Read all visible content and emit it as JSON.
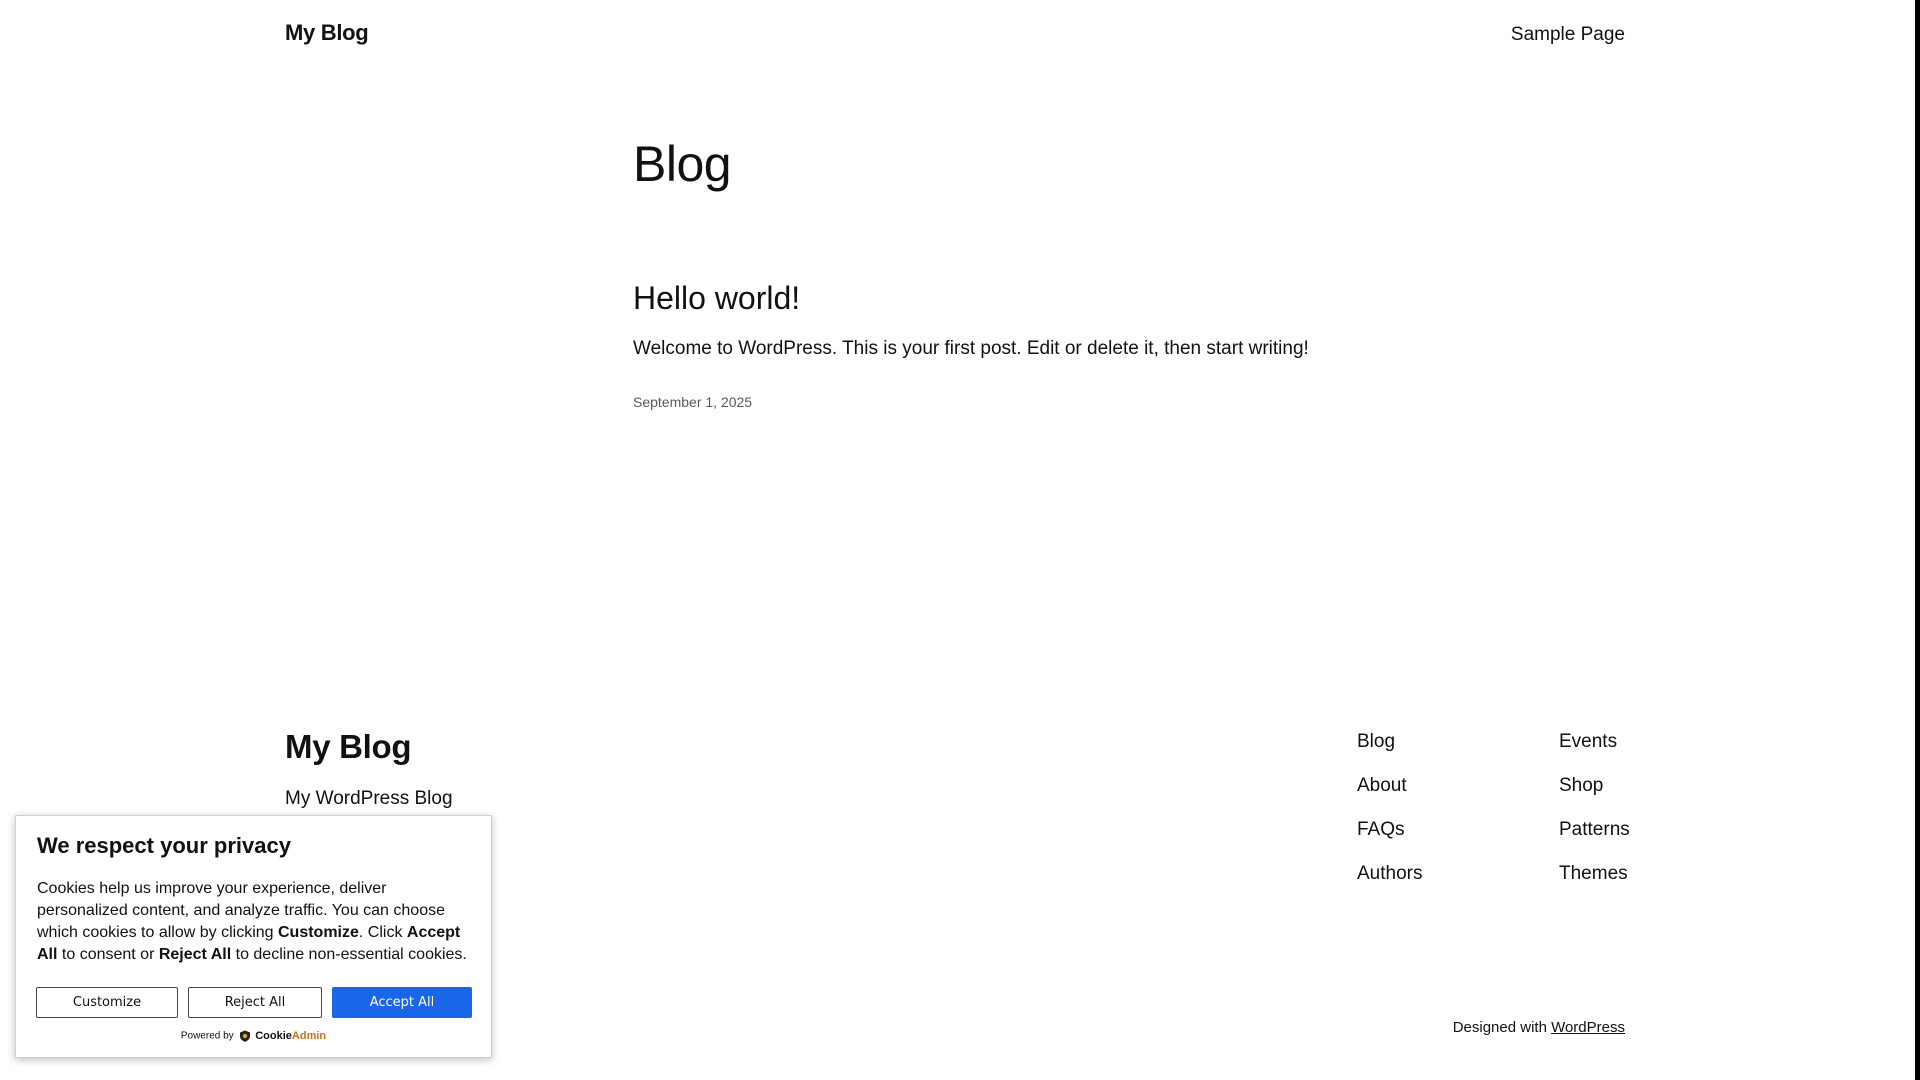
{
  "header": {
    "site_title": "My Blog",
    "nav": [
      "Sample Page"
    ]
  },
  "main": {
    "page_title": "Blog",
    "posts": [
      {
        "title": "Hello world!",
        "excerpt": "Welcome to WordPress. This is your first post. Edit or delete it, then start writing!",
        "date": "September 1, 2025"
      }
    ]
  },
  "footer": {
    "site_title": "My Blog",
    "tagline": "My WordPress Blog",
    "nav_col_1": [
      "Blog",
      "About",
      "FAQs",
      "Authors"
    ],
    "nav_col_2": [
      "Events",
      "Shop",
      "Patterns",
      "Themes"
    ],
    "credit_prefix": "Designed with",
    "credit_link": "WordPress"
  },
  "cookie_banner": {
    "heading": "We respect your privacy",
    "text_1": "Cookies help us improve your experience, deliver personalized content, and analyze traffic. You can choose which cookies to allow by clicking ",
    "text_customize": "Customize",
    "text_2": ". Click ",
    "text_accept": "Accept All",
    "text_3": " to consent or ",
    "text_reject": "Reject All",
    "text_4": " to decline non-essential cookies.",
    "buttons": {
      "customize": "Customize",
      "reject": "Reject All",
      "accept": "Accept All"
    },
    "powered_by": "Powered by",
    "brand_part_1": "Cookie",
    "brand_part_2": "Admin",
    "accent_color": "#1a66e8",
    "brand_icon": "shield-icon"
  }
}
